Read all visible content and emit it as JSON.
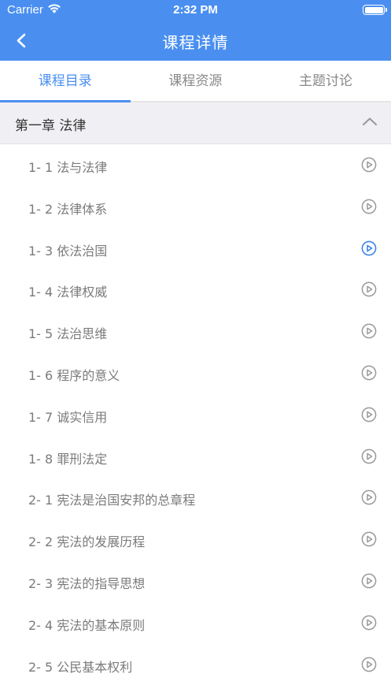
{
  "status_bar": {
    "carrier": "Carrier",
    "time": "2:32 PM"
  },
  "nav": {
    "title": "课程详情"
  },
  "tabs": [
    {
      "label": "课程目录"
    },
    {
      "label": "课程资源"
    },
    {
      "label": "主题讨论"
    }
  ],
  "chapter": {
    "title": "第一章 法律"
  },
  "lessons": [
    {
      "label": "1- 1 法与法律"
    },
    {
      "label": "1- 2 法律体系"
    },
    {
      "label": "1- 3 依法治国"
    },
    {
      "label": "1- 4 法律权威"
    },
    {
      "label": "1- 5 法治思维"
    },
    {
      "label": "1- 6 程序的意义"
    },
    {
      "label": "1- 7 诚实信用"
    },
    {
      "label": "1- 8 罪刑法定"
    },
    {
      "label": "2- 1 宪法是治国安邦的总章程"
    },
    {
      "label": "2- 2 宪法的发展历程"
    },
    {
      "label": "2- 3 宪法的指导思想"
    },
    {
      "label": "2- 4 宪法的基本原则"
    },
    {
      "label": "2- 5 公民基本权利"
    }
  ],
  "colors": {
    "accent": "#4a8ff0",
    "icon_gray": "#9a9a9a",
    "text_gray": "#7b7b7b"
  }
}
